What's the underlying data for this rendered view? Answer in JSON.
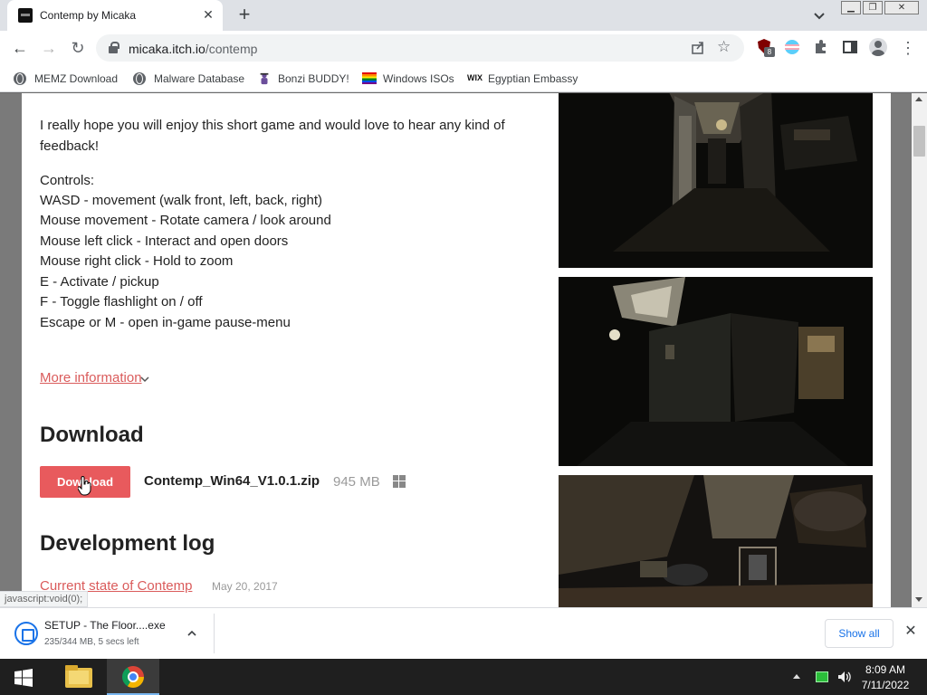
{
  "browser": {
    "tab": {
      "title": "Contemp by Micaka"
    },
    "address": {
      "host": "micaka.itch.io",
      "path": "/contemp"
    },
    "extensions": {
      "ublock_badge": "8"
    },
    "bookmarks": [
      {
        "label": "MEMZ Download",
        "icon": "globe-icon"
      },
      {
        "label": "Malware Database",
        "icon": "globe-icon"
      },
      {
        "label": "Bonzi BUDDY!",
        "icon": "bonzi-icon"
      },
      {
        "label": "Windows ISOs",
        "icon": "rainbow-flag-icon"
      },
      {
        "label": "Egyptian Embassy",
        "icon": "wix-icon",
        "icon_text": "WIX"
      }
    ]
  },
  "page": {
    "intro_fragment": "...p...",
    "intro": "I really hope you will enjoy this short game and would love to hear any kind of feedback!",
    "controls_heading": "Controls:",
    "controls": [
      "WASD - movement (walk front, left, back, right)",
      "Mouse movement - Rotate camera / look around",
      "Mouse left click - Interact and open doors",
      "Mouse right click - Hold to zoom",
      "E - Activate / pickup",
      "F - Toggle flashlight on / off",
      "Escape or M - open in-game pause-menu"
    ],
    "more_info": "More information",
    "download_heading": "Download",
    "download_button": "Download",
    "file_name": "Contemp_Win64_V1.0.1.zip",
    "file_size": "945 MB",
    "devlog_heading": "Development log",
    "devlog_entry": {
      "title": "Current state of Contemp",
      "date": "May 20, 2017"
    },
    "status_tip": "javascript:void(0);"
  },
  "download_shelf": {
    "file": "SETUP - The Floor....exe",
    "status": "235/344 MB, 5 secs left",
    "show_all": "Show all"
  },
  "taskbar": {
    "time": "8:09 AM",
    "date": "7/11/2022"
  },
  "colors": {
    "accent": "#e85a5d",
    "link": "#da5b5b",
    "chrome_blue": "#1a73e8"
  }
}
